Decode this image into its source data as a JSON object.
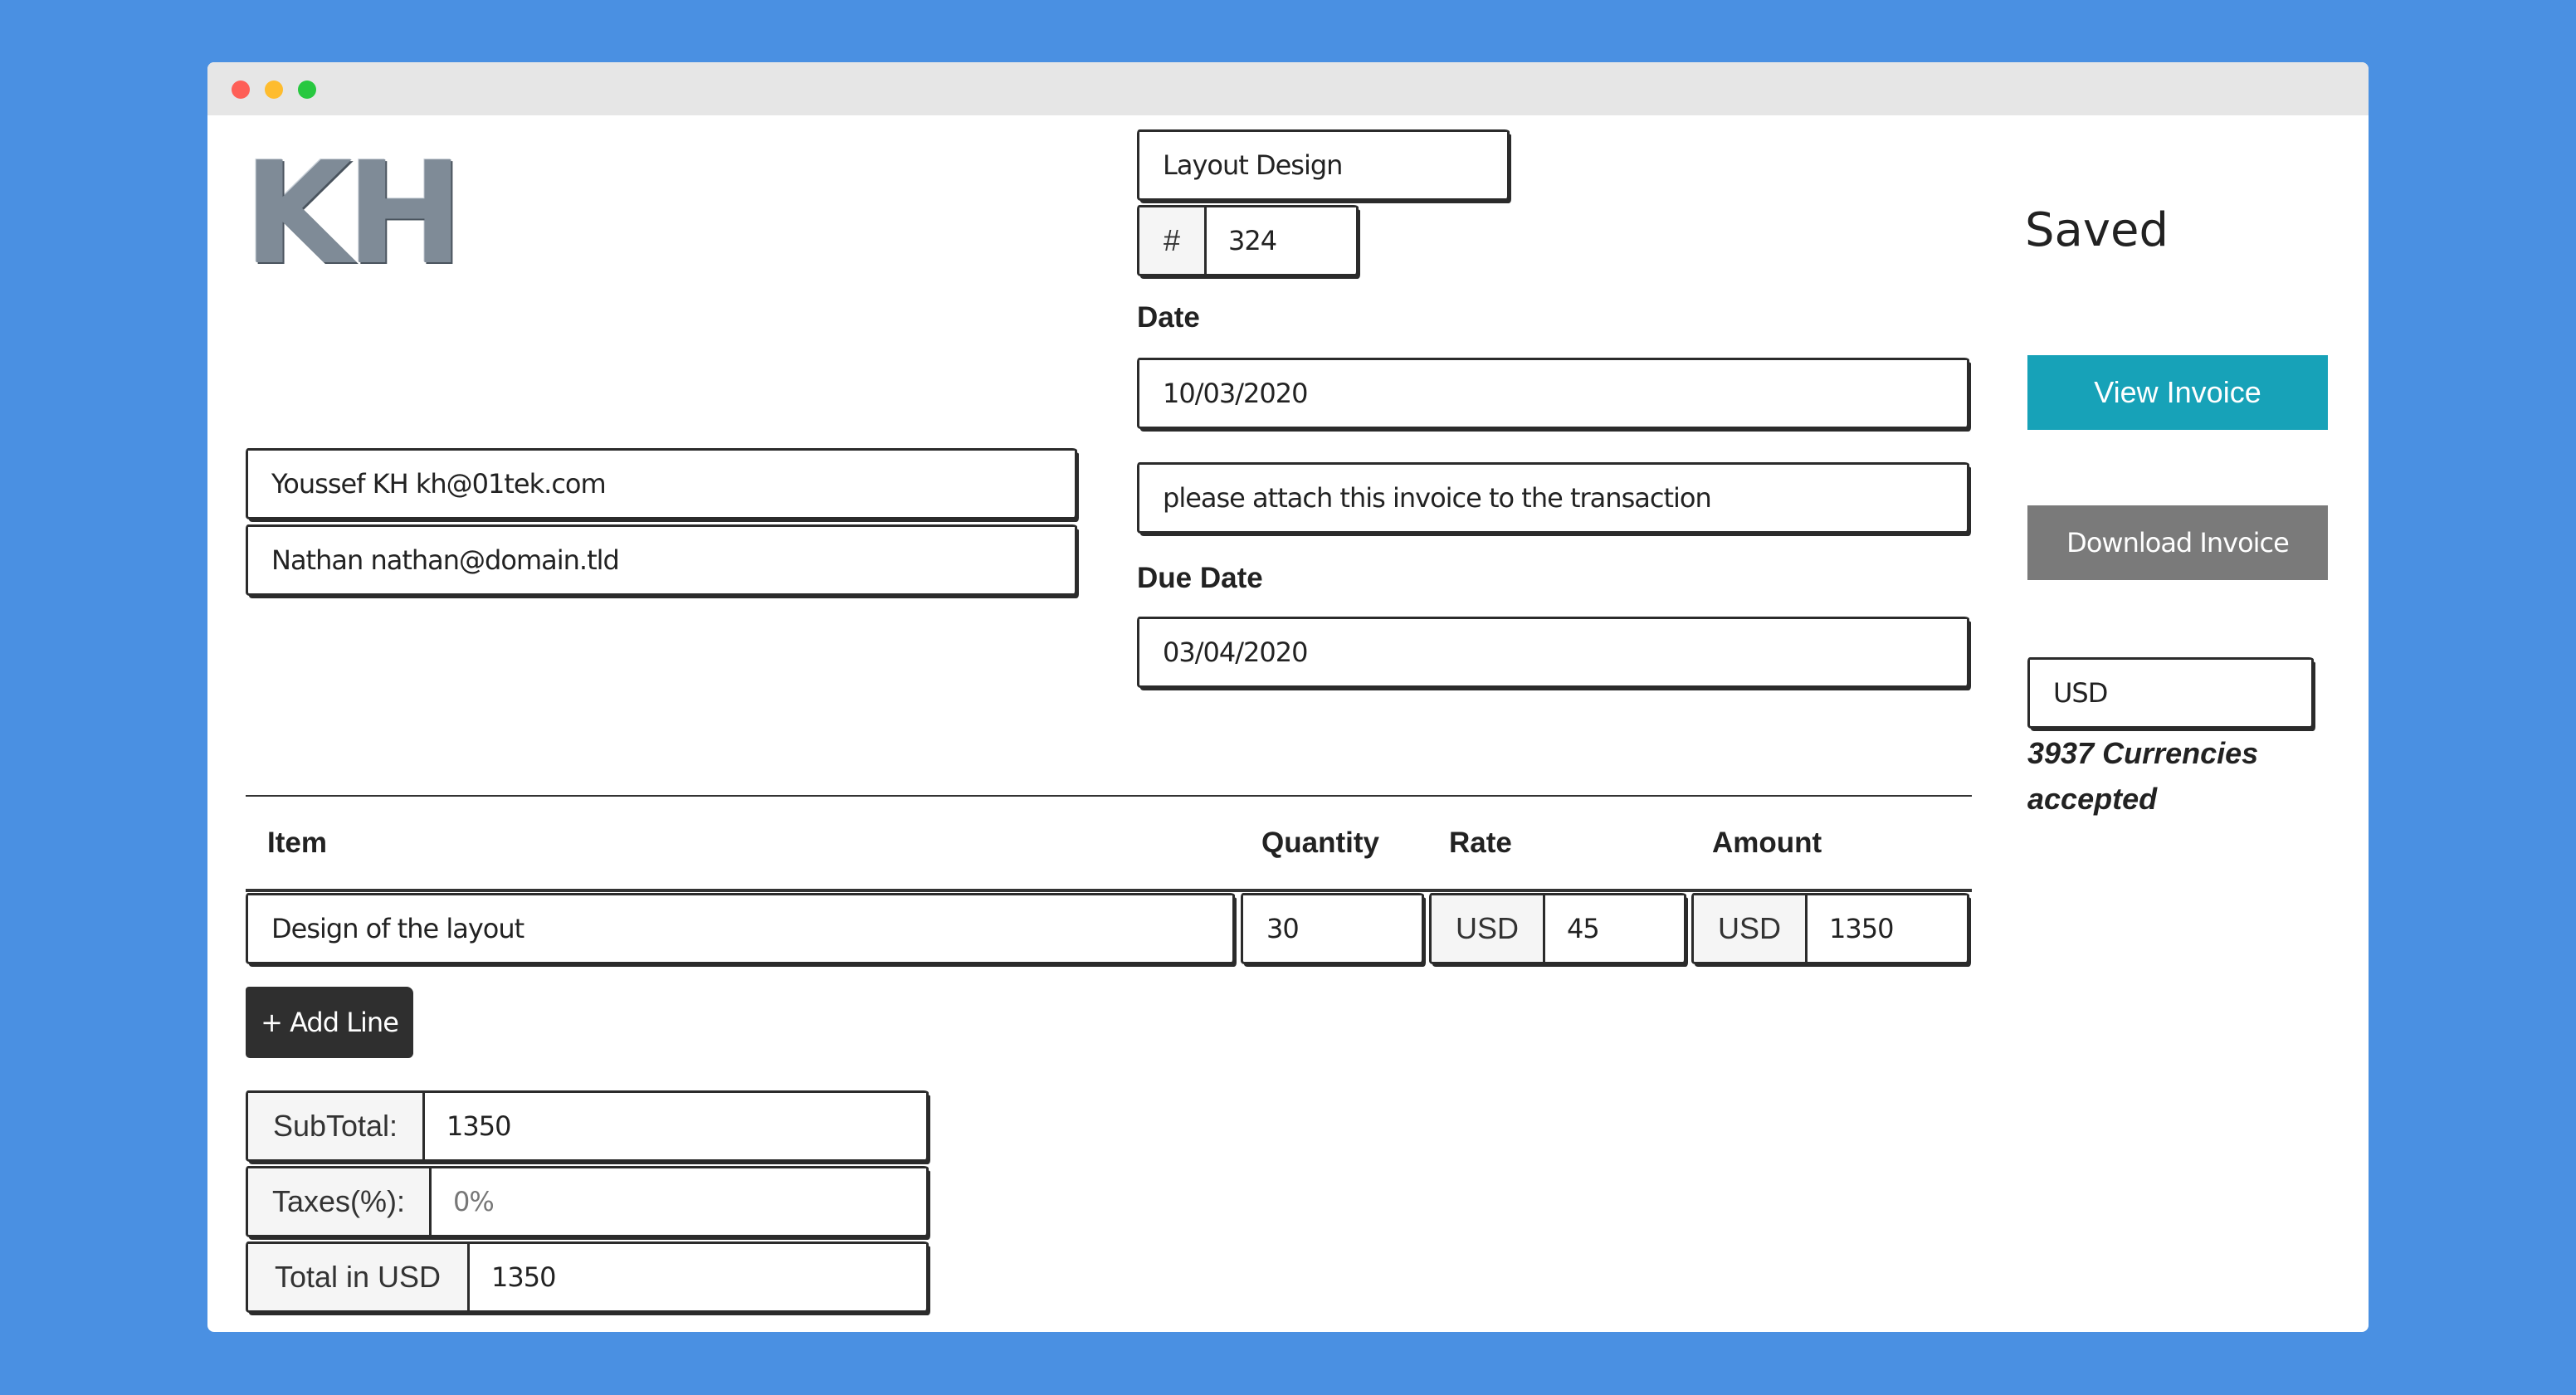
{
  "brand": {
    "logo_text": "KH"
  },
  "invoice": {
    "title": "Layout Design",
    "number_prefix": "#",
    "number": "324",
    "date_label": "Date",
    "date": "10/03/2020",
    "note": "please attach this invoice to the transaction",
    "due_date_label": "Due Date",
    "due_date": "03/04/2020"
  },
  "parties": {
    "from": "Youssef KH kh@01tek.com",
    "to": "Nathan nathan@domain.tld"
  },
  "status": {
    "text": "Saved"
  },
  "actions": {
    "view_label": "View Invoice",
    "download_label": "Download Invoice",
    "add_line_label": "+ Add Line"
  },
  "currency": {
    "value": "USD",
    "note": "3937 Currencies accepted"
  },
  "table": {
    "headers": {
      "item": "Item",
      "quantity": "Quantity",
      "rate": "Rate",
      "amount": "Amount"
    },
    "rows": [
      {
        "item": "Design of the layout",
        "quantity": "30",
        "rate_currency": "USD",
        "rate": "45",
        "amount_currency": "USD",
        "amount": "1350"
      }
    ]
  },
  "totals": {
    "subtotal_label": "SubTotal:",
    "subtotal": "1350",
    "taxes_label": "Taxes(%):",
    "taxes_placeholder": "0%",
    "total_label": "Total in USD",
    "total": "1350"
  },
  "colors": {
    "background": "#4a90e2",
    "view_button": "#17a2b8",
    "download_button": "#7a7a7a",
    "add_line_button": "#2f2f2f"
  }
}
